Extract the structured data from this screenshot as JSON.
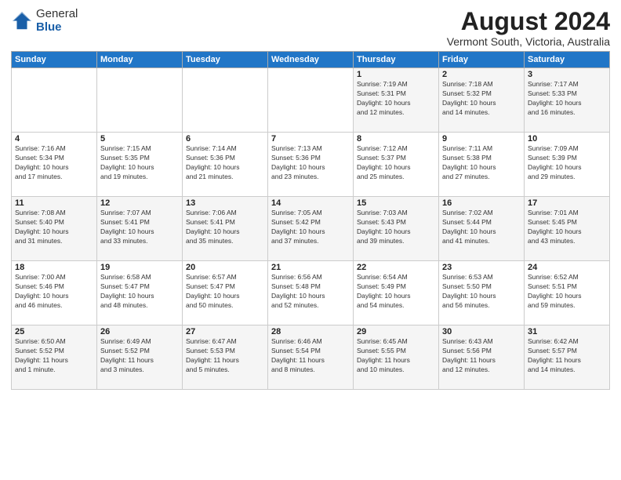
{
  "logo": {
    "general": "General",
    "blue": "Blue"
  },
  "header": {
    "month_year": "August 2024",
    "location": "Vermont South, Victoria, Australia"
  },
  "days_of_week": [
    "Sunday",
    "Monday",
    "Tuesday",
    "Wednesday",
    "Thursday",
    "Friday",
    "Saturday"
  ],
  "weeks": [
    [
      {
        "day": "",
        "info": ""
      },
      {
        "day": "",
        "info": ""
      },
      {
        "day": "",
        "info": ""
      },
      {
        "day": "",
        "info": ""
      },
      {
        "day": "1",
        "info": "Sunrise: 7:19 AM\nSunset: 5:31 PM\nDaylight: 10 hours\nand 12 minutes."
      },
      {
        "day": "2",
        "info": "Sunrise: 7:18 AM\nSunset: 5:32 PM\nDaylight: 10 hours\nand 14 minutes."
      },
      {
        "day": "3",
        "info": "Sunrise: 7:17 AM\nSunset: 5:33 PM\nDaylight: 10 hours\nand 16 minutes."
      }
    ],
    [
      {
        "day": "4",
        "info": "Sunrise: 7:16 AM\nSunset: 5:34 PM\nDaylight: 10 hours\nand 17 minutes."
      },
      {
        "day": "5",
        "info": "Sunrise: 7:15 AM\nSunset: 5:35 PM\nDaylight: 10 hours\nand 19 minutes."
      },
      {
        "day": "6",
        "info": "Sunrise: 7:14 AM\nSunset: 5:36 PM\nDaylight: 10 hours\nand 21 minutes."
      },
      {
        "day": "7",
        "info": "Sunrise: 7:13 AM\nSunset: 5:36 PM\nDaylight: 10 hours\nand 23 minutes."
      },
      {
        "day": "8",
        "info": "Sunrise: 7:12 AM\nSunset: 5:37 PM\nDaylight: 10 hours\nand 25 minutes."
      },
      {
        "day": "9",
        "info": "Sunrise: 7:11 AM\nSunset: 5:38 PM\nDaylight: 10 hours\nand 27 minutes."
      },
      {
        "day": "10",
        "info": "Sunrise: 7:09 AM\nSunset: 5:39 PM\nDaylight: 10 hours\nand 29 minutes."
      }
    ],
    [
      {
        "day": "11",
        "info": "Sunrise: 7:08 AM\nSunset: 5:40 PM\nDaylight: 10 hours\nand 31 minutes."
      },
      {
        "day": "12",
        "info": "Sunrise: 7:07 AM\nSunset: 5:41 PM\nDaylight: 10 hours\nand 33 minutes."
      },
      {
        "day": "13",
        "info": "Sunrise: 7:06 AM\nSunset: 5:41 PM\nDaylight: 10 hours\nand 35 minutes."
      },
      {
        "day": "14",
        "info": "Sunrise: 7:05 AM\nSunset: 5:42 PM\nDaylight: 10 hours\nand 37 minutes."
      },
      {
        "day": "15",
        "info": "Sunrise: 7:03 AM\nSunset: 5:43 PM\nDaylight: 10 hours\nand 39 minutes."
      },
      {
        "day": "16",
        "info": "Sunrise: 7:02 AM\nSunset: 5:44 PM\nDaylight: 10 hours\nand 41 minutes."
      },
      {
        "day": "17",
        "info": "Sunrise: 7:01 AM\nSunset: 5:45 PM\nDaylight: 10 hours\nand 43 minutes."
      }
    ],
    [
      {
        "day": "18",
        "info": "Sunrise: 7:00 AM\nSunset: 5:46 PM\nDaylight: 10 hours\nand 46 minutes."
      },
      {
        "day": "19",
        "info": "Sunrise: 6:58 AM\nSunset: 5:47 PM\nDaylight: 10 hours\nand 48 minutes."
      },
      {
        "day": "20",
        "info": "Sunrise: 6:57 AM\nSunset: 5:47 PM\nDaylight: 10 hours\nand 50 minutes."
      },
      {
        "day": "21",
        "info": "Sunrise: 6:56 AM\nSunset: 5:48 PM\nDaylight: 10 hours\nand 52 minutes."
      },
      {
        "day": "22",
        "info": "Sunrise: 6:54 AM\nSunset: 5:49 PM\nDaylight: 10 hours\nand 54 minutes."
      },
      {
        "day": "23",
        "info": "Sunrise: 6:53 AM\nSunset: 5:50 PM\nDaylight: 10 hours\nand 56 minutes."
      },
      {
        "day": "24",
        "info": "Sunrise: 6:52 AM\nSunset: 5:51 PM\nDaylight: 10 hours\nand 59 minutes."
      }
    ],
    [
      {
        "day": "25",
        "info": "Sunrise: 6:50 AM\nSunset: 5:52 PM\nDaylight: 11 hours\nand 1 minute."
      },
      {
        "day": "26",
        "info": "Sunrise: 6:49 AM\nSunset: 5:52 PM\nDaylight: 11 hours\nand 3 minutes."
      },
      {
        "day": "27",
        "info": "Sunrise: 6:47 AM\nSunset: 5:53 PM\nDaylight: 11 hours\nand 5 minutes."
      },
      {
        "day": "28",
        "info": "Sunrise: 6:46 AM\nSunset: 5:54 PM\nDaylight: 11 hours\nand 8 minutes."
      },
      {
        "day": "29",
        "info": "Sunrise: 6:45 AM\nSunset: 5:55 PM\nDaylight: 11 hours\nand 10 minutes."
      },
      {
        "day": "30",
        "info": "Sunrise: 6:43 AM\nSunset: 5:56 PM\nDaylight: 11 hours\nand 12 minutes."
      },
      {
        "day": "31",
        "info": "Sunrise: 6:42 AM\nSunset: 5:57 PM\nDaylight: 11 hours\nand 14 minutes."
      }
    ]
  ]
}
